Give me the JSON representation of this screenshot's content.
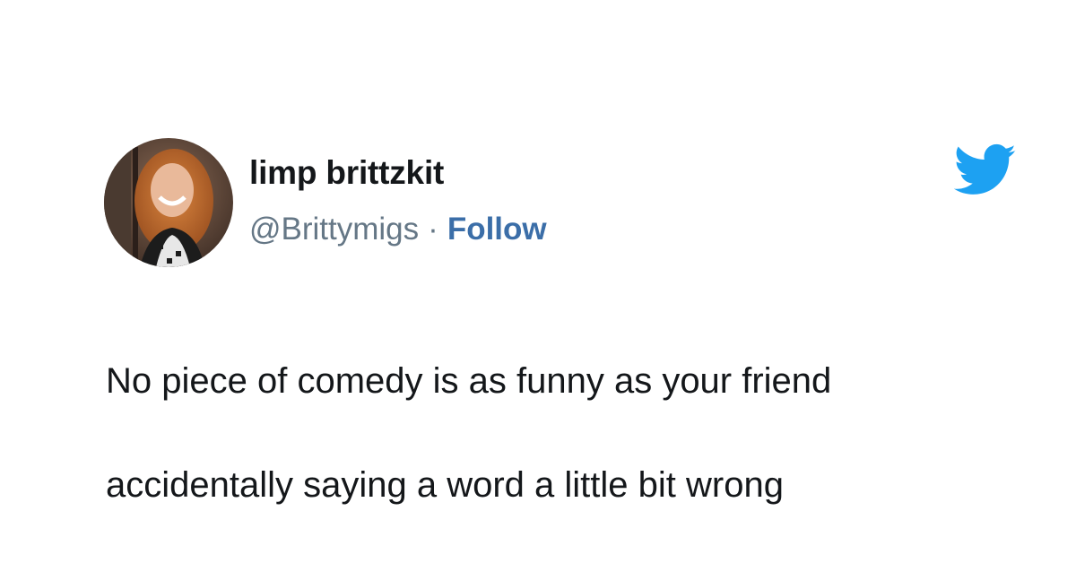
{
  "tweet": {
    "display_name": "limp brittzkit",
    "handle": "@Brittymigs",
    "separator": "·",
    "follow_label": "Follow",
    "text_line1": "No piece of comedy is as funny as your friend",
    "text_line2": "accidentally saying a word a little bit wrong"
  },
  "icons": {
    "avatar": "profile-photo",
    "platform": "twitter-bird-icon"
  },
  "colors": {
    "accent": "#3b6ea8",
    "bird": "#1da1f2",
    "muted": "#657786",
    "text": "#14171a"
  }
}
